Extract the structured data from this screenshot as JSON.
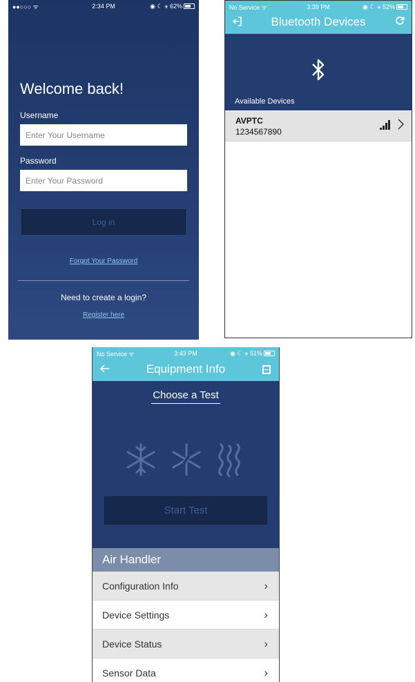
{
  "login": {
    "status": {
      "left": "●●○○○  ᯤ",
      "time": "2:34 PM",
      "right": "◉ ☾ ⚹ 62%"
    },
    "welcome": "Welcome back!",
    "username_label": "Username",
    "username_placeholder": "Enter Your Username",
    "password_label": "Password",
    "password_placeholder": "Enter Your Password",
    "login_button": "Log in",
    "forgot_link": "Forgot Your Password",
    "need_login": "Need to create a login?",
    "register_link": "Register here"
  },
  "bluetooth": {
    "status": {
      "left": "No Service ᯤ",
      "time": "3:39 PM",
      "right": "◉ ☾ ⚹ 52%"
    },
    "title": "Bluetooth Devices",
    "available": "Available Devices",
    "device": {
      "name": "AVPTC",
      "serial": "1234567890"
    }
  },
  "equipment": {
    "status": {
      "left": "No Service ᯤ",
      "time": "3:43 PM",
      "right": "◉ ☾ ⚹ 51%"
    },
    "title": "Equipment Info",
    "choose": "Choose a Test",
    "start_button": "Start Test",
    "section": "Air Handler",
    "rows": [
      "Configuration Info",
      "Device Settings",
      "Device Status",
      "Sensor Data"
    ]
  },
  "colors": {
    "navy": "#243d70",
    "accent": "#5ec6db",
    "link": "#8fc6e8",
    "section": "#7b8da9"
  },
  "icons": [
    "back-icon",
    "refresh-icon",
    "bluetooth-icon",
    "signal-icon",
    "chevron-right-icon",
    "save-icon",
    "snowflake-icon",
    "defrost-icon",
    "heat-icon"
  ]
}
